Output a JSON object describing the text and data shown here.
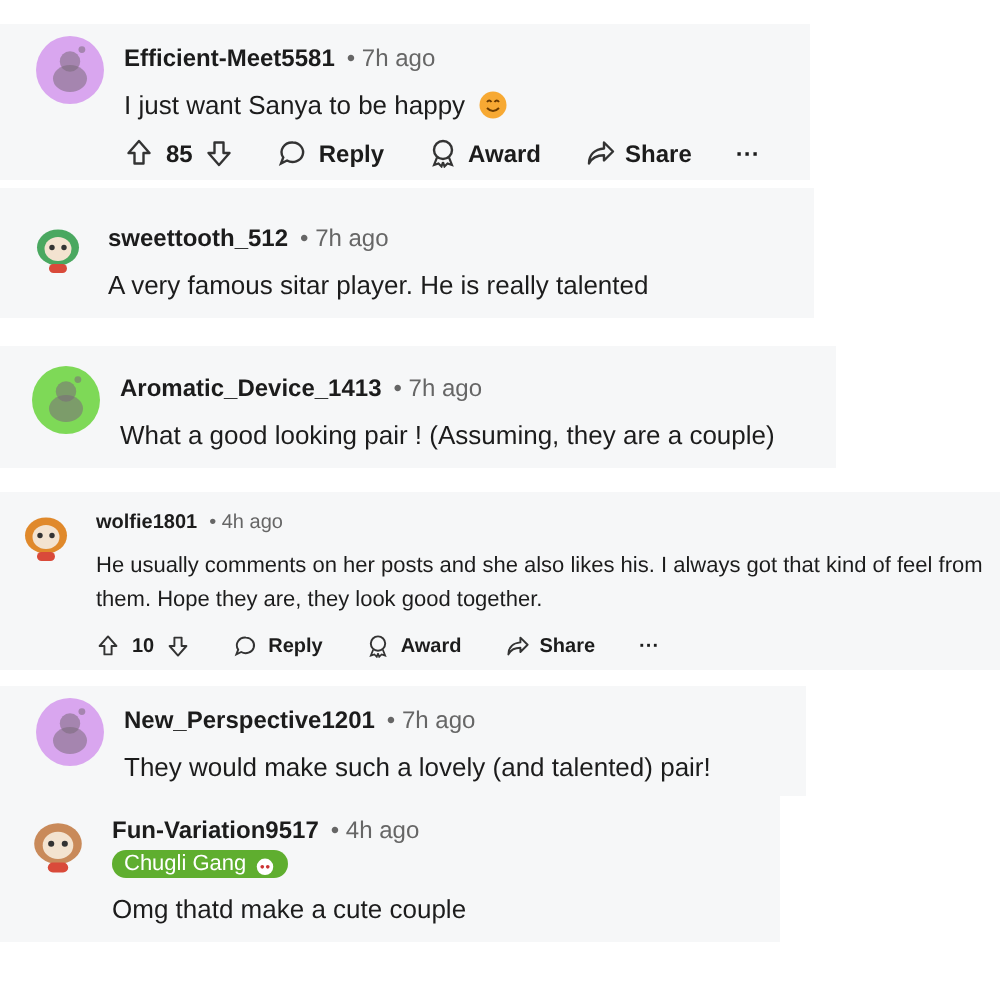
{
  "comments": [
    {
      "user": "Efficient-Meet5581",
      "time": "• 7h ago",
      "text": "I just want Sanya to be happy",
      "emoji": true,
      "avatar": {
        "kind": "snoo",
        "color": "#d9a6ef"
      },
      "actions": {
        "votes": "85",
        "reply": "Reply",
        "award": "Award",
        "share": "Share",
        "more": "···"
      }
    },
    {
      "user": "sweettooth_512",
      "time": "• 7h ago",
      "text": "A very famous sitar player. He is really talented",
      "avatar": {
        "kind": "custom",
        "color": "#4aa860"
      }
    },
    {
      "user": "Aromatic_Device_1413",
      "time": "• 7h ago",
      "text": "What a good looking pair ! (Assuming, they are a couple)",
      "avatar": {
        "kind": "snoo",
        "color": "#7ed957"
      }
    },
    {
      "user": "wolfie1801",
      "time": "• 4h ago",
      "text": "He usually comments on her posts and she also likes his. I always got that kind of feel from them. Hope they are, they look good together.",
      "avatar": {
        "kind": "custom",
        "color": "#e0892b"
      },
      "actions": {
        "votes": "10",
        "reply": "Reply",
        "award": "Award",
        "share": "Share",
        "more": "···"
      }
    },
    {
      "user": "New_Perspective1201",
      "time": "• 7h ago",
      "text": "They would make such a lovely (and talented) pair!",
      "avatar": {
        "kind": "snoo",
        "color": "#d9a6ef"
      }
    },
    {
      "user": "Fun-Variation9517",
      "time": "• 4h ago",
      "text": "Omg thatd make a cute couple",
      "flair": "Chugli Gang",
      "avatar": {
        "kind": "custom",
        "color": "#c98a5a"
      }
    }
  ]
}
